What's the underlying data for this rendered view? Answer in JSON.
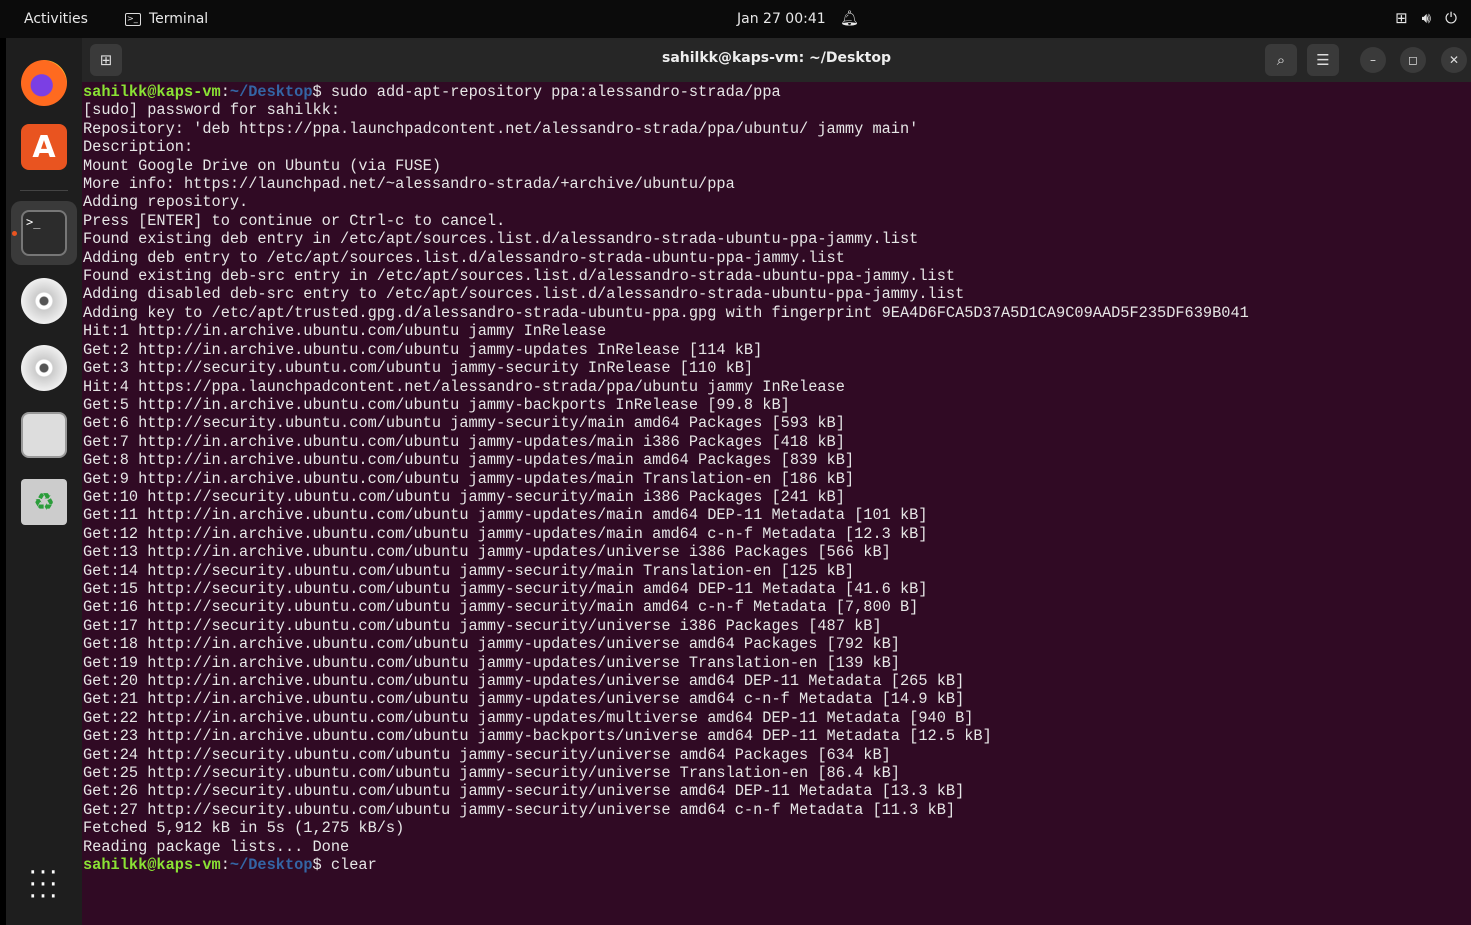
{
  "topbar": {
    "activities": "Activities",
    "app_name": "Terminal",
    "clock": "Jan 27  00:41"
  },
  "window": {
    "title": "sahilkk@kaps-vm: ~/Desktop"
  },
  "prompt": {
    "user_host": "sahilkk@kaps-vm",
    "path": "~/Desktop",
    "symbol": "$ "
  },
  "commands": [
    "sudo add-apt-repository ppa:alessandro-strada/ppa",
    "clear"
  ],
  "output": [
    "[sudo] password for sahilkk:",
    "Repository: 'deb https://ppa.launchpadcontent.net/alessandro-strada/ppa/ubuntu/ jammy main'",
    "Description:",
    "Mount Google Drive on Ubuntu (via FUSE)",
    "More info: https://launchpad.net/~alessandro-strada/+archive/ubuntu/ppa",
    "Adding repository.",
    "Press [ENTER] to continue or Ctrl-c to cancel.",
    "Found existing deb entry in /etc/apt/sources.list.d/alessandro-strada-ubuntu-ppa-jammy.list",
    "Adding deb entry to /etc/apt/sources.list.d/alessandro-strada-ubuntu-ppa-jammy.list",
    "Found existing deb-src entry in /etc/apt/sources.list.d/alessandro-strada-ubuntu-ppa-jammy.list",
    "Adding disabled deb-src entry to /etc/apt/sources.list.d/alessandro-strada-ubuntu-ppa-jammy.list",
    "Adding key to /etc/apt/trusted.gpg.d/alessandro-strada-ubuntu-ppa.gpg with fingerprint 9EA4D6FCA5D37A5D1CA9C09AAD5F235DF639B041",
    "Hit:1 http://in.archive.ubuntu.com/ubuntu jammy InRelease",
    "Get:2 http://in.archive.ubuntu.com/ubuntu jammy-updates InRelease [114 kB]",
    "Get:3 http://security.ubuntu.com/ubuntu jammy-security InRelease [110 kB]",
    "Hit:4 https://ppa.launchpadcontent.net/alessandro-strada/ppa/ubuntu jammy InRelease",
    "Get:5 http://in.archive.ubuntu.com/ubuntu jammy-backports InRelease [99.8 kB]",
    "Get:6 http://security.ubuntu.com/ubuntu jammy-security/main amd64 Packages [593 kB]",
    "Get:7 http://in.archive.ubuntu.com/ubuntu jammy-updates/main i386 Packages [418 kB]",
    "Get:8 http://in.archive.ubuntu.com/ubuntu jammy-updates/main amd64 Packages [839 kB]",
    "Get:9 http://in.archive.ubuntu.com/ubuntu jammy-updates/main Translation-en [186 kB]",
    "Get:10 http://security.ubuntu.com/ubuntu jammy-security/main i386 Packages [241 kB]",
    "Get:11 http://in.archive.ubuntu.com/ubuntu jammy-updates/main amd64 DEP-11 Metadata [101 kB]",
    "Get:12 http://in.archive.ubuntu.com/ubuntu jammy-updates/main amd64 c-n-f Metadata [12.3 kB]",
    "Get:13 http://in.archive.ubuntu.com/ubuntu jammy-updates/universe i386 Packages [566 kB]",
    "Get:14 http://security.ubuntu.com/ubuntu jammy-security/main Translation-en [125 kB]",
    "Get:15 http://security.ubuntu.com/ubuntu jammy-security/main amd64 DEP-11 Metadata [41.6 kB]",
    "Get:16 http://security.ubuntu.com/ubuntu jammy-security/main amd64 c-n-f Metadata [7,800 B]",
    "Get:17 http://security.ubuntu.com/ubuntu jammy-security/universe i386 Packages [487 kB]",
    "Get:18 http://in.archive.ubuntu.com/ubuntu jammy-updates/universe amd64 Packages [792 kB]",
    "Get:19 http://in.archive.ubuntu.com/ubuntu jammy-updates/universe Translation-en [139 kB]",
    "Get:20 http://in.archive.ubuntu.com/ubuntu jammy-updates/universe amd64 DEP-11 Metadata [265 kB]",
    "Get:21 http://in.archive.ubuntu.com/ubuntu jammy-updates/universe amd64 c-n-f Metadata [14.9 kB]",
    "Get:22 http://in.archive.ubuntu.com/ubuntu jammy-updates/multiverse amd64 DEP-11 Metadata [940 B]",
    "Get:23 http://in.archive.ubuntu.com/ubuntu jammy-backports/universe amd64 DEP-11 Metadata [12.5 kB]",
    "Get:24 http://security.ubuntu.com/ubuntu jammy-security/universe amd64 Packages [634 kB]",
    "Get:25 http://security.ubuntu.com/ubuntu jammy-security/universe Translation-en [86.4 kB]",
    "Get:26 http://security.ubuntu.com/ubuntu jammy-security/universe amd64 DEP-11 Metadata [13.3 kB]",
    "Get:27 http://security.ubuntu.com/ubuntu jammy-security/universe amd64 c-n-f Metadata [11.3 kB]",
    "Fetched 5,912 kB in 5s (1,275 kB/s)",
    "Reading package lists... Done"
  ],
  "icons": {
    "firefox": "firefox-icon",
    "store": "app-center-icon",
    "terminal": "terminal-icon",
    "cd": "cd-drive-icon",
    "floppy": "floppy-icon",
    "trash": "trash-icon",
    "apps": "show-apps-icon"
  }
}
